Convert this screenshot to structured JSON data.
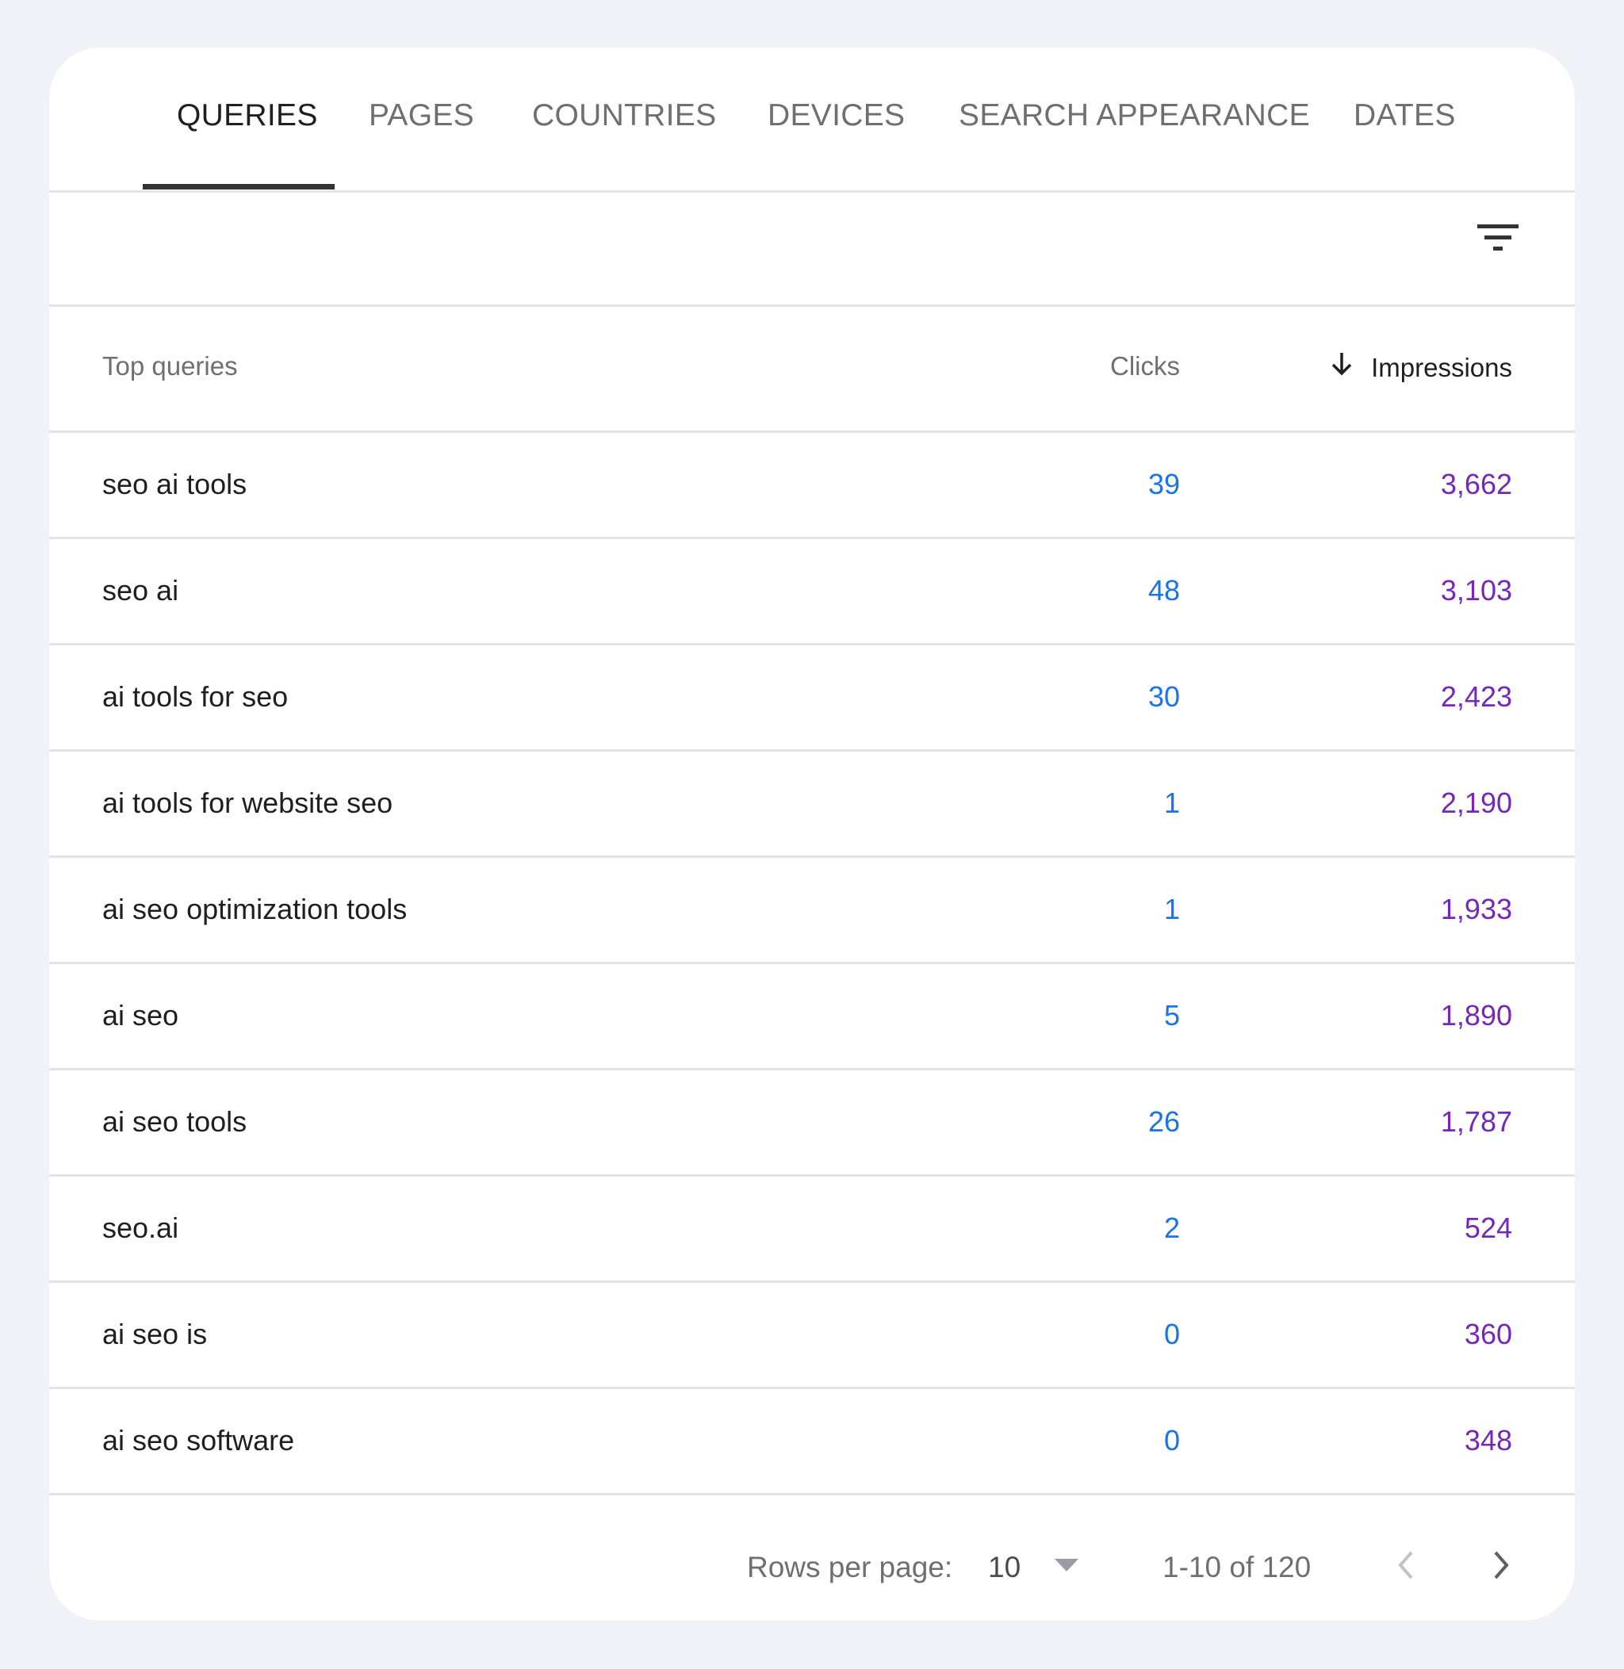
{
  "tabs": [
    {
      "label": "QUERIES",
      "active": true
    },
    {
      "label": "PAGES"
    },
    {
      "label": "COUNTRIES"
    },
    {
      "label": "DEVICES"
    },
    {
      "label": "SEARCH APPEARANCE"
    },
    {
      "label": "DATES"
    }
  ],
  "toolbar": {
    "filter_icon": "filter-list-icon"
  },
  "table": {
    "headers": {
      "query": "Top queries",
      "clicks": "Clicks",
      "impressions": "Impressions",
      "sort_icon": "arrow-down-icon"
    },
    "rows": [
      {
        "query": "seo ai tools",
        "clicks": "39",
        "impressions": "3,662"
      },
      {
        "query": "seo ai",
        "clicks": "48",
        "impressions": "3,103"
      },
      {
        "query": "ai tools for seo",
        "clicks": "30",
        "impressions": "2,423"
      },
      {
        "query": "ai tools for website seo",
        "clicks": "1",
        "impressions": "2,190"
      },
      {
        "query": "ai seo optimization tools",
        "clicks": "1",
        "impressions": "1,933"
      },
      {
        "query": "ai seo",
        "clicks": "5",
        "impressions": "1,890"
      },
      {
        "query": "ai seo tools",
        "clicks": "26",
        "impressions": "1,787"
      },
      {
        "query": "seo.ai",
        "clicks": "2",
        "impressions": "524"
      },
      {
        "query": "ai seo is",
        "clicks": "0",
        "impressions": "360"
      },
      {
        "query": "ai seo software",
        "clicks": "0",
        "impressions": "348"
      }
    ]
  },
  "pagination": {
    "rows_per_page_label": "Rows per page:",
    "rows_per_page_value": "10",
    "range": "1-10 of 120",
    "prev_icon": "chevron-left-icon",
    "next_icon": "chevron-right-icon"
  },
  "colors": {
    "clicks": "#1a73e8",
    "impressions": "#7627bb",
    "background": "#eff2f7"
  }
}
